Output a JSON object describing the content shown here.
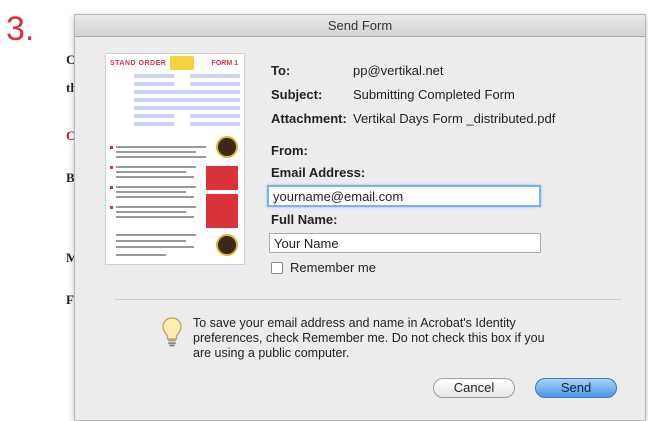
{
  "step_number": "3.",
  "background_fragments": [
    "C",
    "th",
    "C",
    "B",
    "M",
    "F"
  ],
  "dialog": {
    "title": "Send Form",
    "form_preview": {
      "title_left": "STAND ORDER",
      "title_right": "FORM 1"
    },
    "fields": {
      "to_label": "To:",
      "to_value": "pp@vertikal.net",
      "subject_label": "Subject:",
      "subject_value": "Submitting Completed Form",
      "attachment_label": "Attachment:",
      "attachment_value": "Vertikal Days Form _distributed.pdf",
      "from_label": "From:",
      "email_label": "Email Address:",
      "email_value": "yourname@email.com",
      "fullname_label": "Full Name:",
      "fullname_value": "Your Name",
      "remember_label": "Remember me"
    },
    "info_text": "To save your email address and name in Acrobat's Identity preferences, check Remember me. Do not check this box if you are using a public computer.",
    "buttons": {
      "cancel_label": "Cancel",
      "send_label": "Send"
    }
  },
  "colors": {
    "step_number": "#d8323a",
    "send_button": "#4a97e6",
    "focus_ring": "#7ab4f0"
  },
  "icons": {
    "info": "lightbulb-icon"
  }
}
